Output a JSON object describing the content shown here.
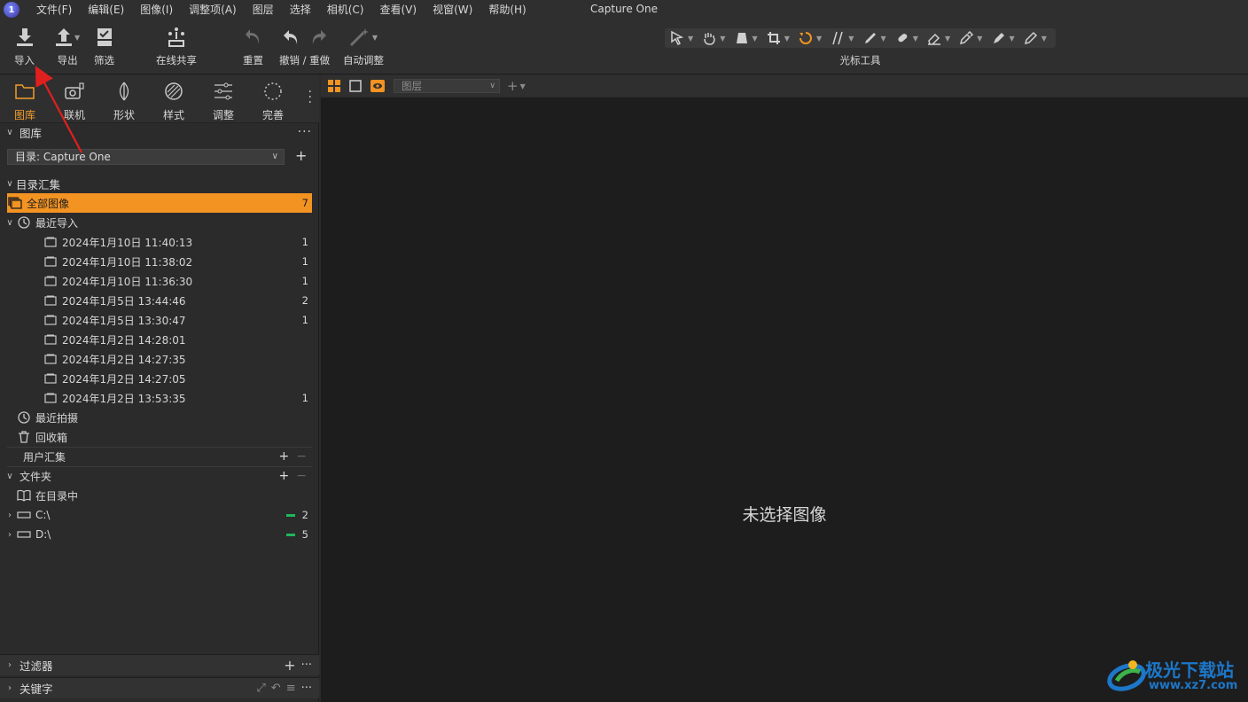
{
  "menu": {
    "items": [
      "文件(F)",
      "编辑(E)",
      "图像(I)",
      "调整项(A)",
      "图层",
      "选择",
      "相机(C)",
      "查看(V)",
      "视窗(W)",
      "帮助(H)"
    ],
    "title": "Capture One",
    "logo": "1"
  },
  "toolbar": {
    "import": "导入",
    "export": "导出",
    "filter": "筛选",
    "share": "在线共享",
    "reset": "重置",
    "undo_redo": "撤销 / 重做",
    "auto_adjust": "自动调整",
    "cursor_tools": "光标工具"
  },
  "tool_tabs": [
    "图库",
    "联机",
    "形状",
    "样式",
    "调整",
    "完善"
  ],
  "library": {
    "header": "图库",
    "catalog_label": "目录:  Capture One",
    "collections_header": "目录汇集",
    "all_images": {
      "label": "全部图像",
      "count": "7"
    },
    "recent_imports": "最近导入",
    "imports": [
      {
        "label": "2024年1月10日 11:40:13",
        "count": "1"
      },
      {
        "label": "2024年1月10日 11:38:02",
        "count": "1"
      },
      {
        "label": "2024年1月10日 11:36:30",
        "count": "1"
      },
      {
        "label": "2024年1月5日  13:44:46",
        "count": "2"
      },
      {
        "label": "2024年1月5日  13:30:47",
        "count": "1"
      },
      {
        "label": "2024年1月2日  14:28:01",
        "count": ""
      },
      {
        "label": "2024年1月2日  14:27:35",
        "count": ""
      },
      {
        "label": "2024年1月2日  14:27:05",
        "count": ""
      },
      {
        "label": "2024年1月2日  13:53:35",
        "count": "1"
      }
    ],
    "recent_captures": "最近拍摄",
    "trash": "回收箱",
    "user_collections": "用户汇集",
    "folders": "文件夹",
    "in_catalog": "在目录中",
    "drives": [
      {
        "label": "C:\\",
        "count": "2"
      },
      {
        "label": "D:\\",
        "count": "5"
      }
    ]
  },
  "bottom": {
    "filters": "过滤器",
    "keywords": "关键字"
  },
  "viewer": {
    "layer_placeholder": "图层",
    "no_image": "未选择图像"
  },
  "watermark": {
    "text": "极光下载站",
    "url": "www.xz7.com"
  },
  "colors": {
    "accent": "#f39322",
    "arrow": "#e0201e",
    "viewer_bg": "#1d1d1d",
    "storage_bar": "#1fb85a"
  }
}
